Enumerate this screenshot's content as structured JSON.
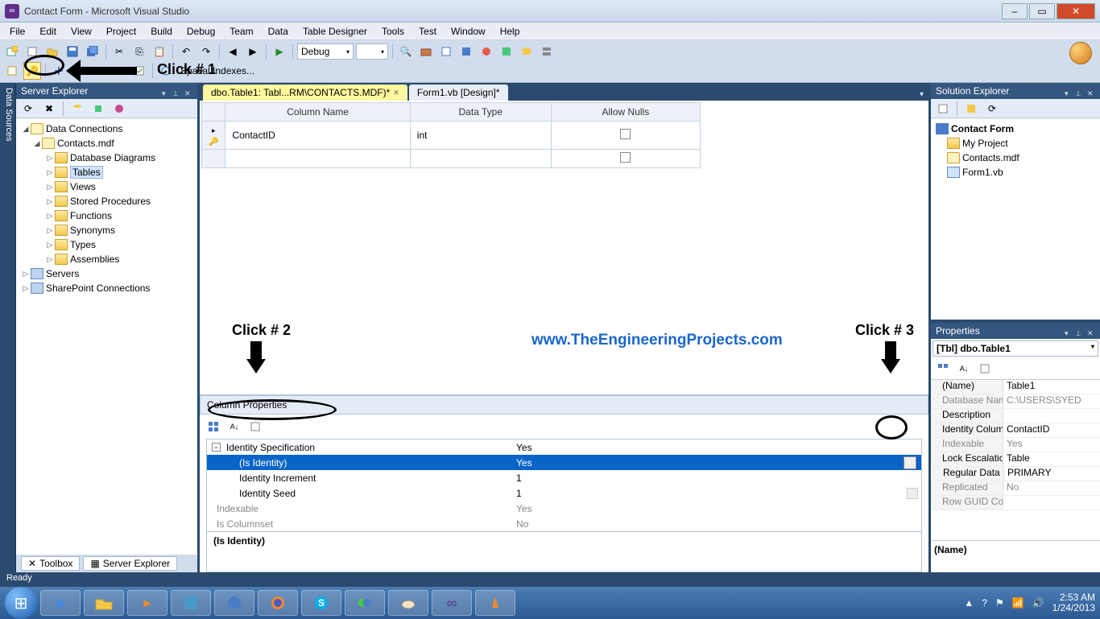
{
  "window": {
    "title": "Contact Form - Microsoft Visual Studio"
  },
  "menu": [
    "File",
    "Edit",
    "View",
    "Project",
    "Build",
    "Debug",
    "Team",
    "Data",
    "Table Designer",
    "Tools",
    "Test",
    "Window",
    "Help"
  ],
  "toolbar": {
    "config_combo": "Debug",
    "spatial_label": "Spatial Indexes..."
  },
  "server_explorer": {
    "title": "Server Explorer",
    "root": "Data Connections",
    "conn": "Contacts.mdf",
    "items": [
      "Database Diagrams",
      "Tables",
      "Views",
      "Stored Procedures",
      "Functions",
      "Synonyms",
      "Types",
      "Assemblies"
    ],
    "servers": "Servers",
    "sharepoint": "SharePoint Connections"
  },
  "left_tab": "Data Sources",
  "bottom_tabs": {
    "toolbox": "Toolbox",
    "server_explorer": "Server Explorer"
  },
  "doc_tabs": {
    "active": "dbo.Table1: Tabl...RM\\CONTACTS.MDF)*",
    "inactive": "Form1.vb [Design]*"
  },
  "table_designer": {
    "headers": [
      "Column Name",
      "Data Type",
      "Allow Nulls"
    ],
    "row1_name": "ContactID",
    "row1_type": "int"
  },
  "column_props": {
    "header": "Column Properties",
    "identity_spec": "Identity Specification",
    "identity_spec_val": "Yes",
    "is_identity": "(Is Identity)",
    "is_identity_val": "Yes",
    "id_inc": "Identity Increment",
    "id_inc_val": "1",
    "id_seed": "Identity Seed",
    "id_seed_val": "1",
    "indexable": "Indexable",
    "indexable_val": "Yes",
    "is_colset": "Is Columnset",
    "is_colset_val": "No",
    "desc": "(Is Identity)"
  },
  "solution_explorer": {
    "title": "Solution Explorer",
    "project": "Contact Form",
    "items": [
      "My Project",
      "Contacts.mdf",
      "Form1.vb"
    ]
  },
  "properties": {
    "title": "Properties",
    "object": "[Tbl] dbo.Table1",
    "rows": [
      {
        "k": "(Name)",
        "v": "Table1"
      },
      {
        "k": "Database Nam",
        "v": "C:\\USERS\\SYED",
        "dim": true
      },
      {
        "k": "Description",
        "v": ""
      },
      {
        "k": "Identity Colum",
        "v": "ContactID"
      },
      {
        "k": "Indexable",
        "v": "Yes",
        "dim": true
      },
      {
        "k": "Lock Escalatio",
        "v": "Table"
      },
      {
        "k": "Regular Data",
        "v": "PRIMARY",
        "exp": true
      },
      {
        "k": "Replicated",
        "v": "No",
        "dim": true
      },
      {
        "k": "Row GUID Co",
        "v": "",
        "dim": true
      }
    ],
    "desc": "(Name)"
  },
  "status": "Ready",
  "annotations": {
    "click1": "Click # 1",
    "click2": "Click # 2",
    "click3": "Click # 3",
    "watermark": "www.TheEngineeringProjects.com"
  },
  "tray": {
    "time": "2:53 AM",
    "date": "1/24/2013"
  }
}
